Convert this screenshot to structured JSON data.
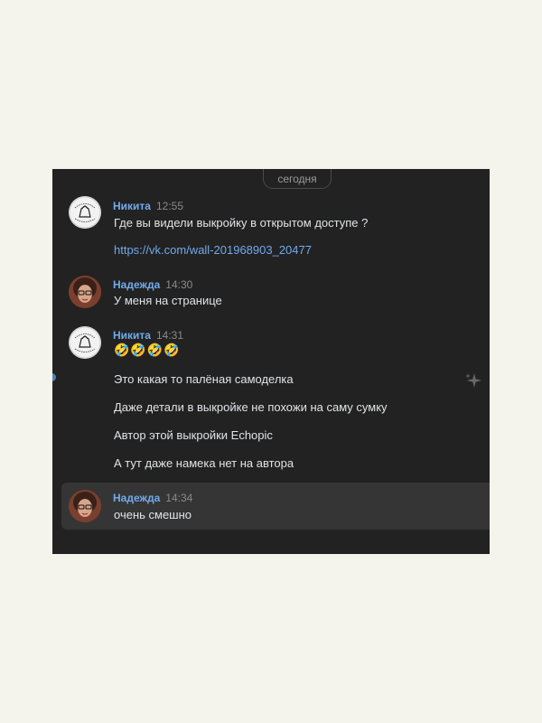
{
  "date_divider": "сегодня",
  "messages": [
    {
      "author": "Никита",
      "time": "12:55",
      "avatar": "pattern-logo-avatar",
      "lines": [
        "Где вы видели выкройку в открытом доступе ?",
        "https://vk.com/wall-201968903_20477"
      ]
    },
    {
      "author": "Надежда",
      "time": "14:30",
      "avatar": "woman-photo-avatar",
      "lines": [
        "У меня на странице"
      ]
    },
    {
      "author": "Никита",
      "time": "14:31",
      "avatar": "pattern-logo-avatar",
      "emoji": "🤣🤣🤣🤣",
      "lines": [
        "Это какая то палёная самоделка",
        "Даже детали в выкройке не похожи на саму сумку",
        "Автор этой выкройки Echopic",
        "А тут даже намека нет на автора"
      ]
    },
    {
      "author": "Надежда",
      "time": "14:34",
      "avatar": "woman-photo-avatar",
      "lines": [
        "очень смешно"
      ]
    }
  ],
  "colors": {
    "background": "#222222",
    "author": "#71aaeb",
    "text": "#e1e3e6",
    "highlight": "#353535"
  }
}
